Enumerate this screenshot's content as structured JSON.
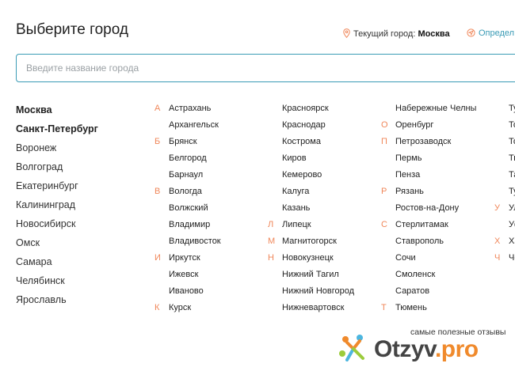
{
  "title": "Выберите город",
  "current_city": {
    "label": "Текущий город:",
    "city": "Москва"
  },
  "detect_label": "Определ",
  "search": {
    "placeholder": "Введите название города",
    "value": ""
  },
  "popular_cities": [
    {
      "name": "Москва",
      "bold": true
    },
    {
      "name": "Санкт-Петербург",
      "bold": true
    },
    {
      "name": "Воронеж",
      "bold": false
    },
    {
      "name": "Волгоград",
      "bold": false
    },
    {
      "name": "Екатеринбург",
      "bold": false
    },
    {
      "name": "Калининград",
      "bold": false
    },
    {
      "name": "Новосибирск",
      "bold": false
    },
    {
      "name": "Омск",
      "bold": false
    },
    {
      "name": "Самара",
      "bold": false
    },
    {
      "name": "Челябинск",
      "bold": false
    },
    {
      "name": "Ярославль",
      "bold": false
    }
  ],
  "city_columns": [
    [
      {
        "letter": "А",
        "city": "Астрахань"
      },
      {
        "letter": "",
        "city": "Архангельск"
      },
      {
        "letter": "Б",
        "city": "Брянск"
      },
      {
        "letter": "",
        "city": "Белгород"
      },
      {
        "letter": "",
        "city": "Барнаул"
      },
      {
        "letter": "В",
        "city": "Вологда"
      },
      {
        "letter": "",
        "city": "Волжский"
      },
      {
        "letter": "",
        "city": "Владимир"
      },
      {
        "letter": "",
        "city": "Владивосток"
      },
      {
        "letter": "И",
        "city": "Иркутск"
      },
      {
        "letter": "",
        "city": "Ижевск"
      },
      {
        "letter": "",
        "city": "Иваново"
      },
      {
        "letter": "К",
        "city": "Курск"
      }
    ],
    [
      {
        "letter": "",
        "city": "Красноярск"
      },
      {
        "letter": "",
        "city": "Краснодар"
      },
      {
        "letter": "",
        "city": "Кострома"
      },
      {
        "letter": "",
        "city": "Киров"
      },
      {
        "letter": "",
        "city": "Кемерово"
      },
      {
        "letter": "",
        "city": "Калуга"
      },
      {
        "letter": "",
        "city": "Казань"
      },
      {
        "letter": "Л",
        "city": "Липецк"
      },
      {
        "letter": "М",
        "city": "Магнитогорск"
      },
      {
        "letter": "Н",
        "city": "Новокузнецк"
      },
      {
        "letter": "",
        "city": "Нижний Тагил"
      },
      {
        "letter": "",
        "city": "Нижний Новгород"
      },
      {
        "letter": "",
        "city": "Нижневартовск"
      }
    ],
    [
      {
        "letter": "",
        "city": "Набережные Челны"
      },
      {
        "letter": "О",
        "city": "Оренбург"
      },
      {
        "letter": "П",
        "city": "Петрозаводск"
      },
      {
        "letter": "",
        "city": "Пермь"
      },
      {
        "letter": "",
        "city": "Пенза"
      },
      {
        "letter": "Р",
        "city": "Рязань"
      },
      {
        "letter": "",
        "city": "Ростов-на-Дону"
      },
      {
        "letter": "С",
        "city": "Стерлитамак"
      },
      {
        "letter": "",
        "city": "Ставрополь"
      },
      {
        "letter": "",
        "city": "Сочи"
      },
      {
        "letter": "",
        "city": "Смоленск"
      },
      {
        "letter": "",
        "city": "Саратов"
      },
      {
        "letter": "Т",
        "city": "Тюмень"
      }
    ],
    [
      {
        "letter": "",
        "city": "Ту"
      },
      {
        "letter": "",
        "city": "То"
      },
      {
        "letter": "",
        "city": "То"
      },
      {
        "letter": "",
        "city": "Тв"
      },
      {
        "letter": "",
        "city": "Та"
      },
      {
        "letter": "",
        "city": "Ту"
      },
      {
        "letter": "У",
        "city": "Ул"
      },
      {
        "letter": "",
        "city": "Уф"
      },
      {
        "letter": "Х",
        "city": "Ха"
      },
      {
        "letter": "Ч",
        "city": "Че"
      }
    ]
  ],
  "watermark": {
    "tagline": "самые полезные отзывы",
    "brand": "Otzyv",
    "brand_suffix": ".pro"
  },
  "colors": {
    "accent": "#3a9bb5",
    "letter": "#f0875a",
    "brand_orange": "#f08a2c"
  }
}
